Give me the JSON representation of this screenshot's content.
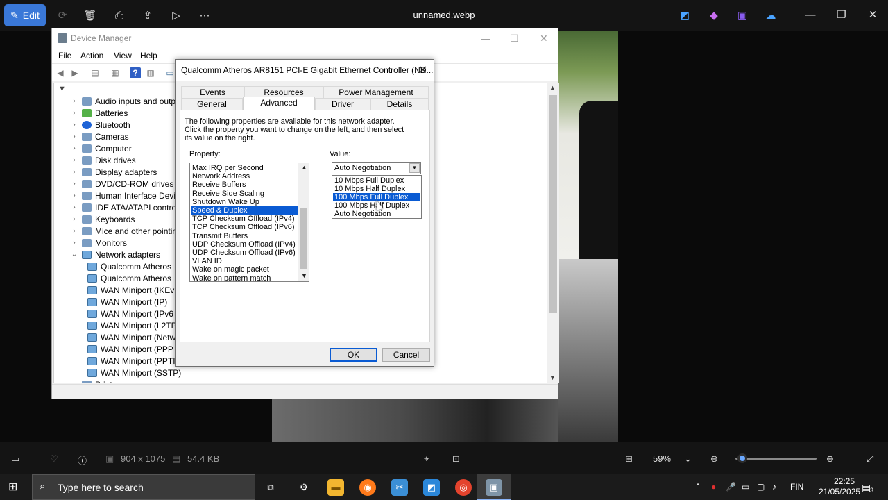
{
  "viewer": {
    "edit_label": "Edit",
    "title": "unnamed.webp",
    "dimensions": "904 x 1075",
    "file_size": "54.4 KB",
    "zoom": "59%",
    "zoom_level_fraction": 0.08
  },
  "device_manager": {
    "title": "Device Manager",
    "menu": [
      "File",
      "Action",
      "View",
      "Help"
    ],
    "tree_items": [
      {
        "label": "Audio inputs and outpu",
        "expanded": false
      },
      {
        "label": "Batteries",
        "expanded": false
      },
      {
        "label": "Bluetooth",
        "expanded": false
      },
      {
        "label": "Cameras",
        "expanded": false
      },
      {
        "label": "Computer",
        "expanded": false
      },
      {
        "label": "Disk drives",
        "expanded": false
      },
      {
        "label": "Display adapters",
        "expanded": false
      },
      {
        "label": "DVD/CD-ROM drives",
        "expanded": false
      },
      {
        "label": "Human Interface Device",
        "expanded": false
      },
      {
        "label": "IDE ATA/ATAPI controlle",
        "expanded": false
      },
      {
        "label": "Keyboards",
        "expanded": false
      },
      {
        "label": "Mice and other pointing",
        "expanded": false
      },
      {
        "label": "Monitors",
        "expanded": false
      },
      {
        "label": "Network adapters",
        "expanded": true
      },
      {
        "label": "Qualcomm Atheros",
        "child": true
      },
      {
        "label": "Qualcomm Atheros",
        "child": true
      },
      {
        "label": "WAN Miniport (IKEv",
        "child": true
      },
      {
        "label": "WAN Miniport (IP)",
        "child": true
      },
      {
        "label": "WAN Miniport (IPv6",
        "child": true
      },
      {
        "label": "WAN Miniport (L2TP",
        "child": true
      },
      {
        "label": "WAN Miniport (Netw",
        "child": true
      },
      {
        "label": "WAN Miniport (PPP",
        "child": true
      },
      {
        "label": "WAN Miniport (PPTI",
        "child": true
      },
      {
        "label": "WAN Miniport (SSTP)",
        "child": true
      },
      {
        "label": "Print queues",
        "expanded": false
      }
    ]
  },
  "dialog": {
    "title": "Qualcomm Atheros AR8151 PCI-E Gigabit Ethernet Controller (ND...",
    "tabs_back": [
      "Events",
      "Resources",
      "Power Management"
    ],
    "tabs_front": [
      "General",
      "Advanced",
      "Driver",
      "Details"
    ],
    "active_tab": "Advanced",
    "description": "The following properties are available for this network adapter. Click the property you want to change on the left, and then select its value on the right.",
    "property_label": "Property:",
    "value_label": "Value:",
    "properties": [
      "Max IRQ per Second",
      "Network Address",
      "Receive Buffers",
      "Receive Side Scaling",
      "Shutdown Wake Up",
      "Speed & Duplex",
      "TCP Checksum Offload (IPv4)",
      "TCP Checksum Offload (IPv6)",
      "Transmit Buffers",
      "UDP Checksum Offload (IPv4)",
      "UDP Checksum Offload (IPv6)",
      "VLAN ID",
      "Wake on magic packet",
      "Wake on pattern match"
    ],
    "selected_property": "Speed & Duplex",
    "value_current": "Auto Negotiation",
    "value_options": [
      "10 Mbps Full Duplex",
      "10 Mbps Half Duplex",
      "100 Mbps Full Duplex",
      "100 Mbps Half Duplex",
      "Auto Negotiation"
    ],
    "highlighted_option": "100 Mbps Full Duplex",
    "ok_label": "OK",
    "cancel_label": "Cancel"
  },
  "taskbar": {
    "search_placeholder": "Type here to search",
    "language": "FIN",
    "time": "22:25",
    "date": "21/05/2025",
    "notification_count": "3"
  },
  "colors": {
    "accent": "#3a78d8",
    "selection": "#0a5bd3"
  }
}
